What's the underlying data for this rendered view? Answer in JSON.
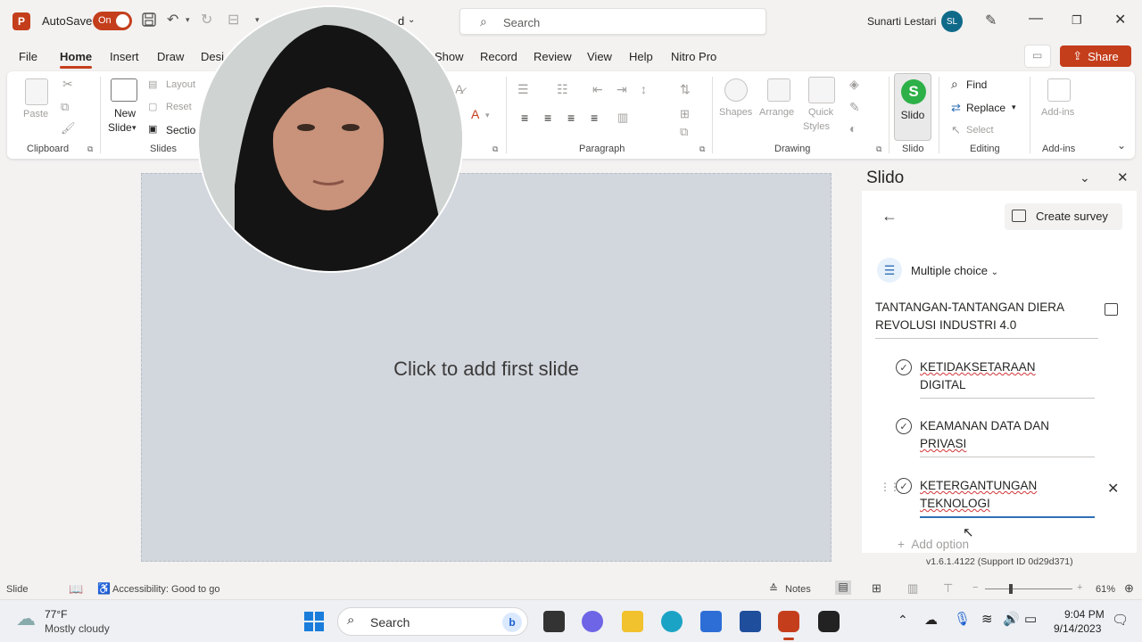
{
  "titlebar": {
    "autosave_label": "AutoSave",
    "toggle_label": "On",
    "file_suffix": "d",
    "search_placeholder": "Search",
    "user_name": "Sunarti Lestari",
    "user_initials": "SL"
  },
  "tabs": [
    "File",
    "Home",
    "Insert",
    "Draw",
    "Desi",
    "Show",
    "Record",
    "Review",
    "View",
    "Help",
    "Nitro Pro"
  ],
  "share_label": "Share",
  "ribbon": {
    "clipboard": {
      "paste": "Paste",
      "label": "Clipboard"
    },
    "slides": {
      "new_slide": "New",
      "new_slide2": "Slide",
      "layout": "Layout",
      "reset": "Reset",
      "section": "Sectio",
      "label": "Slides"
    },
    "paragraph_label": "Paragraph",
    "drawing": {
      "shapes": "Shapes",
      "arrange": "Arrange",
      "quick": "Quick",
      "styles": "Styles",
      "label": "Drawing"
    },
    "slido": {
      "button": "Slido",
      "label": "Slido"
    },
    "editing": {
      "find": "Find",
      "replace": "Replace",
      "select": "Select",
      "label": "Editing"
    },
    "addins": {
      "button": "Add-ins",
      "label": "Add-ins"
    }
  },
  "slide": {
    "placeholder": "Click to add first slide"
  },
  "slido_pane": {
    "title": "Slido",
    "create_survey": "Create survey",
    "question_type": "Multiple choice",
    "question_line1": "TANTANGAN-TANTANGAN DIERA",
    "question_line2": "REVOLUSI INDUSTRI 4.0",
    "options": [
      {
        "line1": "KETIDAKSETARAAN",
        "line2": "DIGITAL"
      },
      {
        "line1": "KEAMANAN DATA DAN",
        "line2": "PRIVASI"
      },
      {
        "line1": "KETERGANTUNGAN",
        "line2": "TEKNOLOGI"
      }
    ],
    "add_option": "Add option",
    "version": "v1.6.1.4122 (Support ID 0d29d371)"
  },
  "statusbar": {
    "view": "Slide",
    "accessibility": "Accessibility: Good to go",
    "notes": "Notes",
    "zoom": "61%"
  },
  "taskbar": {
    "weather_temp": "77°F",
    "weather_desc": "Mostly cloudy",
    "search": "Search",
    "time": "9:04 PM",
    "date": "9/14/2023"
  },
  "colors": {
    "accent": "#c43e1c",
    "slido_green": "#2eb048",
    "link_blue": "#2f6fb6"
  }
}
